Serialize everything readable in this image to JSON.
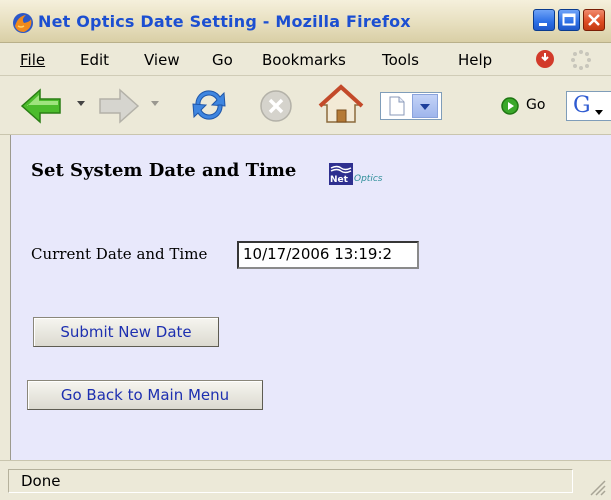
{
  "window": {
    "title": "Net Optics Date Setting - Mozilla Firefox"
  },
  "menu": {
    "items": [
      "File",
      "Edit",
      "View",
      "Go",
      "Bookmarks",
      "Tools",
      "Help"
    ]
  },
  "toolbar": {
    "go_label": "Go",
    "search_engine_glyph": "G"
  },
  "page": {
    "heading": "Set System Date and Time",
    "logo_text_net": "Net",
    "logo_text_optics": "Optics",
    "current_datetime_label": "Current Date and Time",
    "current_datetime_value": "10/17/2006 13:19:2",
    "submit_button": "Submit New Date",
    "back_button": "Go Back to Main Menu"
  },
  "status": {
    "text": "Done"
  },
  "colors": {
    "page_background": "#e8e8fb",
    "title_text": "#1c4fd1",
    "button_text": "#1d2fb0"
  },
  "icons": {
    "app": "firefox-icon",
    "back": "back-arrow-icon",
    "forward": "forward-arrow-icon",
    "reload": "reload-icon",
    "stop": "stop-icon",
    "home": "home-icon",
    "go": "go-icon",
    "adblock": "stop-sign-icon",
    "throbber": "throbber-icon"
  }
}
